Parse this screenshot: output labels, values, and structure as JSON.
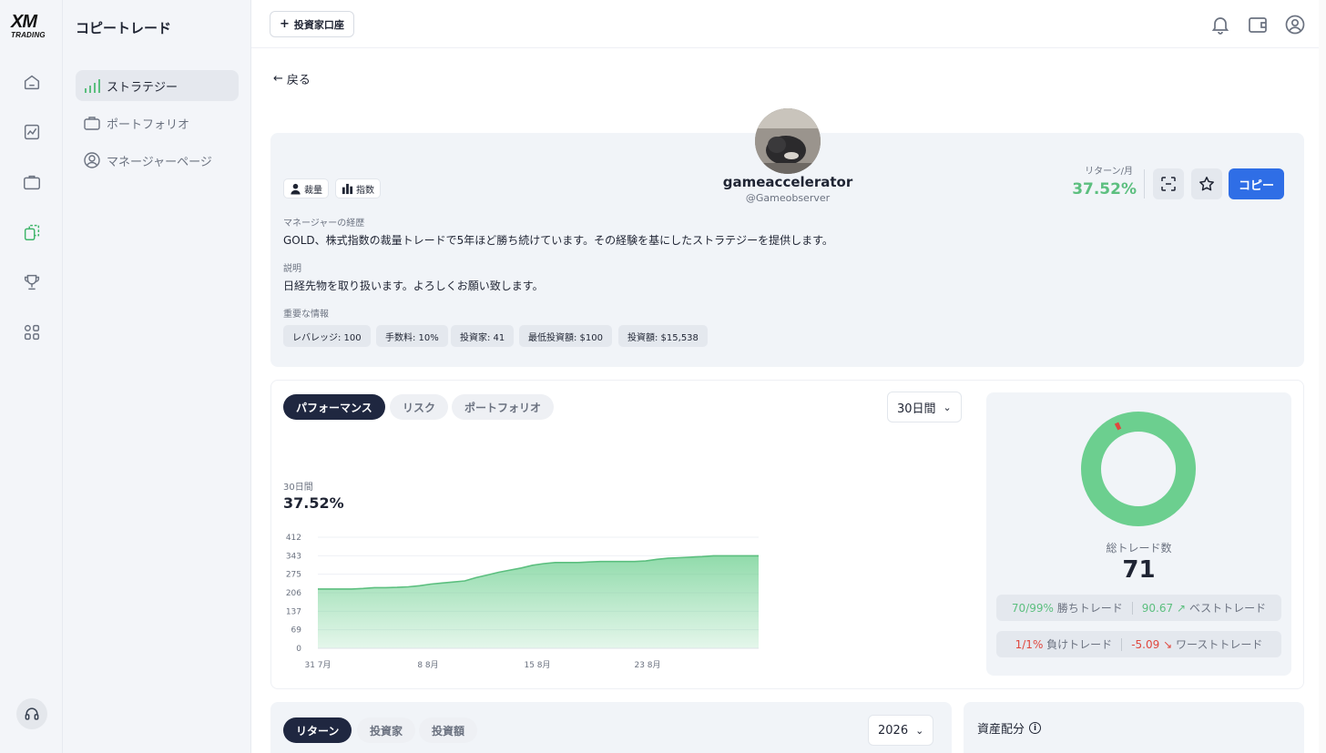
{
  "brand": {
    "logo_main": "XM",
    "logo_sub": "TRADING"
  },
  "sidebar": {
    "title": "コピートレード",
    "items": [
      {
        "label": "ストラテジー",
        "icon": "signal-bars-icon",
        "active": true
      },
      {
        "label": "ポートフォリオ",
        "icon": "briefcase-icon",
        "active": false
      },
      {
        "label": "マネージャーページ",
        "icon": "user-circle-icon",
        "active": false
      }
    ]
  },
  "rail": {
    "icons": [
      "home-icon",
      "chart-icon",
      "briefcase-icon",
      "copy-icon",
      "trophy-icon",
      "apps-icon",
      "headset-icon"
    ]
  },
  "header": {
    "add_account": "投資家口座",
    "icons": [
      "bell-icon",
      "wallet-icon",
      "profile-icon"
    ]
  },
  "back_label": "戻る",
  "profile": {
    "name": "gameaccelerator",
    "handle": "@Gameobserver",
    "tags": [
      "裁量",
      "指数"
    ],
    "history_label": "マネージャーの経歴",
    "history_text": "GOLD、株式指数の裁量トレードで5年ほど勝ち続けています。その経験を基にしたストラテジーを提供します。",
    "desc_label": "説明",
    "desc_text": "日経先物を取り扱います。よろしくお願い致します。",
    "info_label": "重要な情報",
    "chips": [
      "レバレッジ: 100",
      "手数料: 10%",
      "投資家: 41",
      "最低投資額: $100",
      "投資額: $15,538"
    ],
    "return_label": "リターン/月",
    "return_value": "37.52%",
    "copy_label": "コピー"
  },
  "performance": {
    "tabs": [
      "パフォーマンス",
      "リスク",
      "ポートフォリオ"
    ],
    "period": "30日間",
    "period_label": "30日間",
    "period_value": "37.52%"
  },
  "chart_data": {
    "type": "area",
    "x_ticks": [
      "31 7月",
      "8 8月",
      "15 8月",
      "23 8月"
    ],
    "y_ticks": [
      0,
      69,
      137,
      206,
      275,
      343,
      412
    ],
    "ylim": [
      0,
      412
    ],
    "values": [
      220,
      220,
      220,
      220,
      222,
      225,
      225,
      226,
      228,
      232,
      238,
      242,
      246,
      250,
      262,
      272,
      282,
      290,
      298,
      308,
      314,
      318,
      318,
      318,
      320,
      322,
      322,
      322,
      322,
      324,
      330,
      334,
      336,
      338,
      340,
      343,
      343,
      343,
      343,
      343
    ],
    "color": "#6ccf8f",
    "grid": true
  },
  "stats": {
    "total_label": "総トレード数",
    "total_value": "71",
    "win_value": "70/99%",
    "win_label": "勝ちトレード",
    "best_value": "90.67",
    "best_label": "ベストトレード",
    "loss_value": "1/1%",
    "loss_label": "負けトレード",
    "worst_value": "-5.09",
    "worst_label": "ワーストトレード",
    "donut_win_fraction": 0.9859,
    "colors": {
      "win": "#6ccf8f",
      "loss": "#e0473e"
    }
  },
  "bottom": {
    "tabs": [
      "リターン",
      "投資家",
      "投資額"
    ],
    "year": "2026",
    "allocation_label": "資産配分"
  }
}
